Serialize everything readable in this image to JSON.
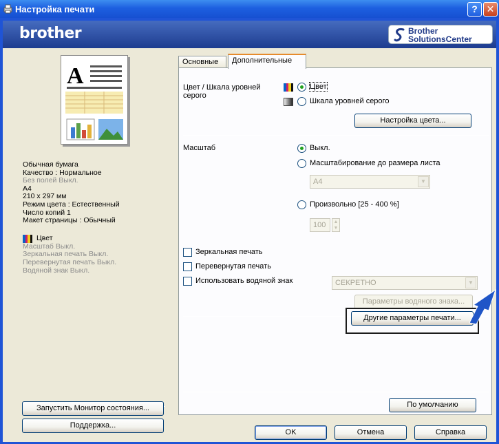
{
  "window": {
    "title": "Настройка печати",
    "help": "?",
    "close": "✕"
  },
  "banner": {
    "brand": "brother",
    "solutions_line1": "Brother",
    "solutions_line2": "SolutionsCenter"
  },
  "summary": {
    "lines_active": [
      "Обычная бумага",
      "Качество : Нормальное"
    ],
    "line_inactive1": "Без полей Выкл.",
    "lines_active2": [
      "A4",
      "210 x 297 мм",
      "Режим цвета : Естественный",
      "Число копий 1",
      "Макет страницы : Обычный"
    ],
    "color": "Цвет",
    "lines_inactive2": [
      "Масштаб Выкл.",
      "Зеркальная печать Выкл.",
      "Перевернутая печать Выкл.",
      "Водяной знак Выкл."
    ]
  },
  "left_buttons": {
    "monitor": "Запустить Монитор состояния...",
    "support": "Поддержка..."
  },
  "tabs": [
    "Основные",
    "Дополнительные"
  ],
  "color_section": {
    "label": "Цвет / Шкала уровней серого",
    "option_color": "Цвет",
    "option_gray": "Шкала уровней серого",
    "settings_button": "Настройка цвета..."
  },
  "scale_section": {
    "label": "Масштаб",
    "option_off": "Выкл.",
    "option_fit": "Масштабирование до размера листа",
    "fit_value": "A4",
    "option_custom": "Произвольно [25 - 400 %]",
    "custom_value": "100"
  },
  "checkboxes": {
    "mirror": "Зеркальная печать",
    "reverse": "Перевернутая печать",
    "watermark": "Использовать водяной знак",
    "watermark_value": "СЕКРЕТНО",
    "watermark_params": "Параметры водяного знака..."
  },
  "other_params_button": "Другие параметры печати...",
  "default_button": "По умолчанию",
  "footer": {
    "ok": "OK",
    "cancel": "Отмена",
    "help": "Справка"
  },
  "colors": {
    "titlebar": "#1d5fe0",
    "dialog": "#ece9d8",
    "radio_dot": "#21a121",
    "tab_accent": "#e68b2c"
  }
}
